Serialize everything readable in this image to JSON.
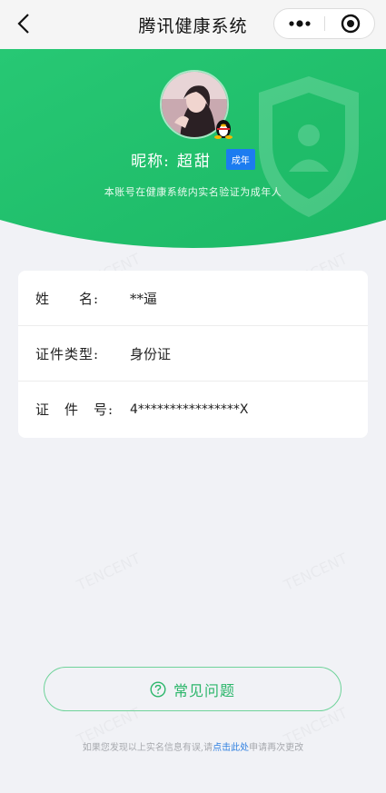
{
  "navbar": {
    "title": "腾讯健康系统",
    "back_icon": "chevron-left-icon",
    "more_icon": "more-dots-icon",
    "close_icon": "target-close-icon"
  },
  "profile": {
    "nickname_label": "昵称:",
    "nickname": "超甜",
    "adult_badge": "成年",
    "verify_note": "本账号在健康系统内实名验证为成年人",
    "avatar_icon": "avatar-photo",
    "qq_icon": "qq-penguin-icon",
    "shield_icon": "shield-user-icon"
  },
  "info": {
    "rows": [
      {
        "label": "姓　　名:",
        "value": "**逼"
      },
      {
        "label": "证件类型:",
        "value": "身份证"
      },
      {
        "label": "证　件　号:",
        "value": "4****************X"
      }
    ]
  },
  "faq": {
    "label": "常见问题",
    "icon": "question-circle-icon"
  },
  "footer": {
    "prefix": "如果您发现以上实名信息有误,请",
    "link": "点击此处",
    "suffix": "申请再次更改"
  },
  "colors": {
    "brand_green": "#22c36f",
    "badge_blue": "#1c7cf0",
    "link_blue": "#2e7fe0"
  }
}
